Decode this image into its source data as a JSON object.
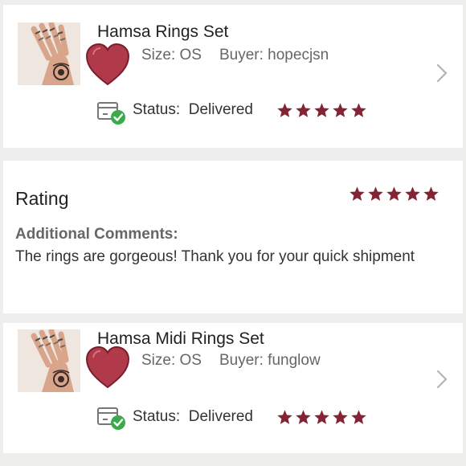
{
  "colors": {
    "accent": "#822433",
    "status_check": "#3aaa4a",
    "muted_text": "#666666",
    "background": "#eeeeec"
  },
  "orders": [
    {
      "title": "Hamsa Rings Set",
      "size": "Size: OS",
      "buyer": "Buyer: hopecjsn",
      "status_label": "Status:",
      "status_value": "Delivered",
      "rating": 5,
      "icons": [
        "product-thumbnail",
        "heart-icon",
        "chevron-right-icon",
        "delivered-box-icon",
        "star-icon"
      ]
    },
    {
      "title": "Hamsa Midi Rings Set",
      "size": "Size: OS",
      "buyer": "Buyer: funglow",
      "status_label": "Status:",
      "status_value": "Delivered",
      "rating": 5,
      "icons": [
        "product-thumbnail",
        "heart-icon",
        "chevron-right-icon",
        "delivered-box-icon",
        "star-icon"
      ]
    }
  ],
  "rating_section": {
    "heading": "Rating",
    "rating": 5,
    "comments_label": "Additional Comments:",
    "comments_text": "The rings are gorgeous! Thank you for your quick shipment"
  }
}
